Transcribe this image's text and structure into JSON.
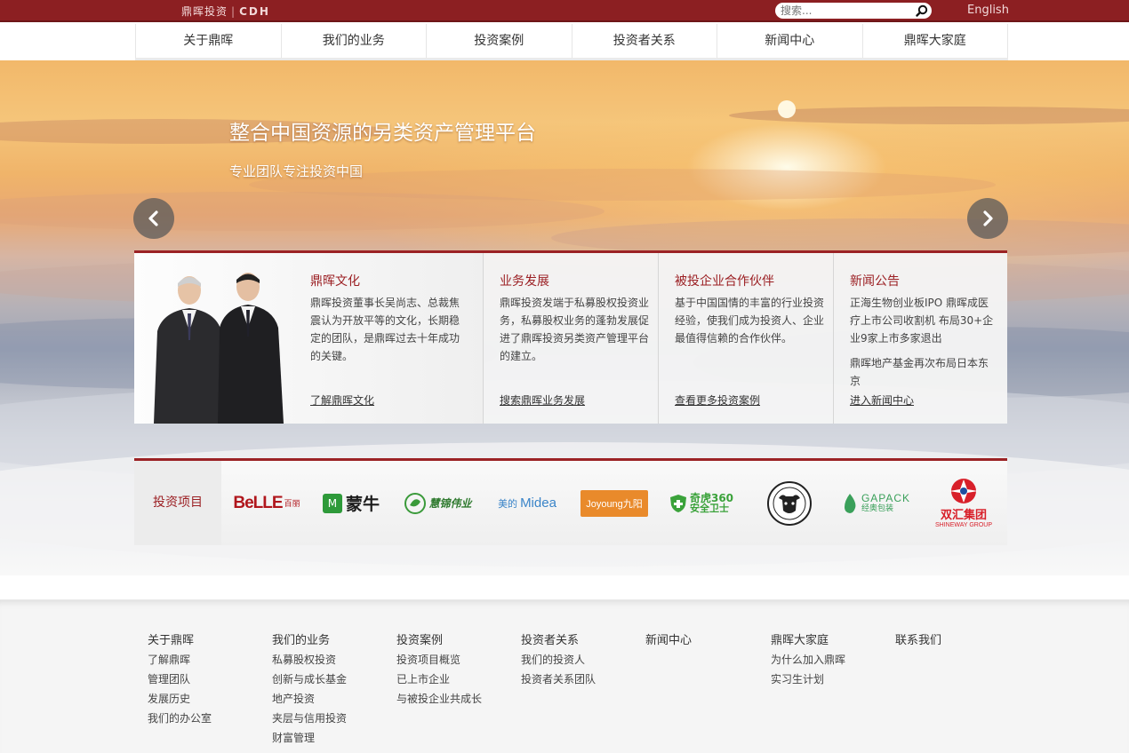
{
  "header": {
    "logo_cn": "鼎晖投资",
    "logo_sep": "|",
    "logo_en": "CDH",
    "search_placeholder": "搜索...",
    "language_link": "English"
  },
  "nav": {
    "items": [
      "关于鼎晖",
      "我们的业务",
      "投资案例",
      "投资者关系",
      "新闻中心",
      "鼎晖大家庭"
    ]
  },
  "hero": {
    "title": "整合中国资源的另类资产管理平台",
    "subtitle": "专业团队专注投资中国"
  },
  "panels": [
    {
      "title": "鼎晖文化",
      "text": "鼎晖投资董事长吴尚志、总裁焦震认为开放平等的文化，长期稳定的团队，是鼎晖过去十年成功的关键。",
      "link": "了解鼎晖文化"
    },
    {
      "title": "业务发展",
      "text": "鼎晖投资发端于私募股权投资业务，私募股权业务的蓬勃发展促进了鼎晖投资另类资产管理平台的建立。",
      "link": "搜索鼎晖业务发展"
    },
    {
      "title": "被投企业合作伙伴",
      "text": "基于中国国情的丰富的行业投资经验，使我们成为投资人、企业最值得信赖的合作伙伴。",
      "link": "查看更多投资案例"
    },
    {
      "title": "新闻公告",
      "news1": "正海生物创业板IPO 鼎晖成医疗上市公司收割机 布局30+企业9家上市多家退出",
      "news2": "鼎晖地产基金再次布局日本东京",
      "link": "进入新闻中心"
    }
  ],
  "portfolio": {
    "label": "投资项目",
    "logos": {
      "belle": "BeLLE",
      "belle_cn": "百丽",
      "mengniu": "蒙牛",
      "mengniu_sub": "M",
      "greenland": "慧锦伟业",
      "midea_cn": "美的",
      "midea": "Midea",
      "joyoung": "Joyoung",
      "joyoung_cn": "九阳",
      "qihoo": "奇虎360",
      "qihoo_sub": "安全卫士",
      "gapack": "GAPACK",
      "gapack_cn": "经奥包装",
      "shuanghui": "双汇集团",
      "shuanghui_en": "SHINEWAY GROUP"
    }
  },
  "footer": {
    "columns": [
      {
        "title": "关于鼎晖",
        "links": [
          "了解鼎晖",
          "管理团队",
          "发展历史",
          "我们的办公室"
        ]
      },
      {
        "title": "我们的业务",
        "links": [
          "私募股权投资",
          "创新与成长基金",
          "地产投资",
          "夹层与信用投资",
          "财富管理"
        ]
      },
      {
        "title": "投资案例",
        "links": [
          "投资项目概览",
          "已上市企业",
          "与被投企业共成长"
        ]
      },
      {
        "title": "投资者关系",
        "links": [
          "我们的投资人",
          "投资者关系团队"
        ]
      },
      {
        "title": "新闻中心",
        "links": []
      },
      {
        "title": "鼎晖大家庭",
        "links": [
          "为什么加入鼎晖",
          "实习生计划"
        ]
      },
      {
        "title": "联系我们",
        "links": []
      }
    ]
  },
  "colors": {
    "brand": "#8c1f22",
    "accent_red": "#9b2225"
  }
}
